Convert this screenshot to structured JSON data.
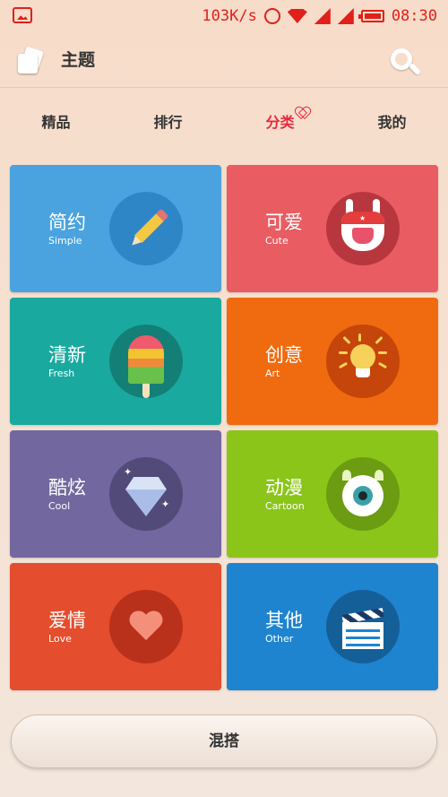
{
  "status_bar": {
    "speed": "103K/s",
    "time": "08:30",
    "icons": [
      "gallery-icon",
      "alarm-icon",
      "wifi-icon",
      "signal-icon",
      "battery-icon"
    ],
    "color": "#e0201a"
  },
  "header": {
    "title": "主题",
    "icons": [
      "theme-app-icon",
      "search-icon"
    ]
  },
  "tabs": {
    "items": [
      {
        "label": "精品"
      },
      {
        "label": "排行"
      },
      {
        "label": "分类"
      },
      {
        "label": "我的"
      }
    ],
    "active_index": 2,
    "active_color": "#e8283c"
  },
  "categories": [
    {
      "zh": "简约",
      "en": "Simple",
      "icon": "pencil-icon",
      "color": "#4aa3df",
      "circle": "#2f86c7"
    },
    {
      "zh": "可爱",
      "en": "Cute",
      "icon": "bunny-icon",
      "color": "#e85c62",
      "circle": "#b8373e"
    },
    {
      "zh": "清新",
      "en": "Fresh",
      "icon": "popsicle-icon",
      "color": "#1aa99f",
      "circle": "#147f77"
    },
    {
      "zh": "创意",
      "en": "Art",
      "icon": "lightbulb-icon",
      "color": "#f06a0f",
      "circle": "#c5450a"
    },
    {
      "zh": "酷炫",
      "en": "Cool",
      "icon": "diamond-icon",
      "color": "#72689f",
      "circle": "#524a78"
    },
    {
      "zh": "动漫",
      "en": "Cartoon",
      "icon": "monster-eye-icon",
      "color": "#8bc51a",
      "circle": "#6b9c12"
    },
    {
      "zh": "爱情",
      "en": "Love",
      "icon": "heart-icon",
      "color": "#e44d2d",
      "circle": "#b9301b"
    },
    {
      "zh": "其他",
      "en": "Other",
      "icon": "clapperboard-icon",
      "color": "#1e84d0",
      "circle": "#155f99"
    }
  ],
  "bottom_button": {
    "label": "混搭"
  }
}
